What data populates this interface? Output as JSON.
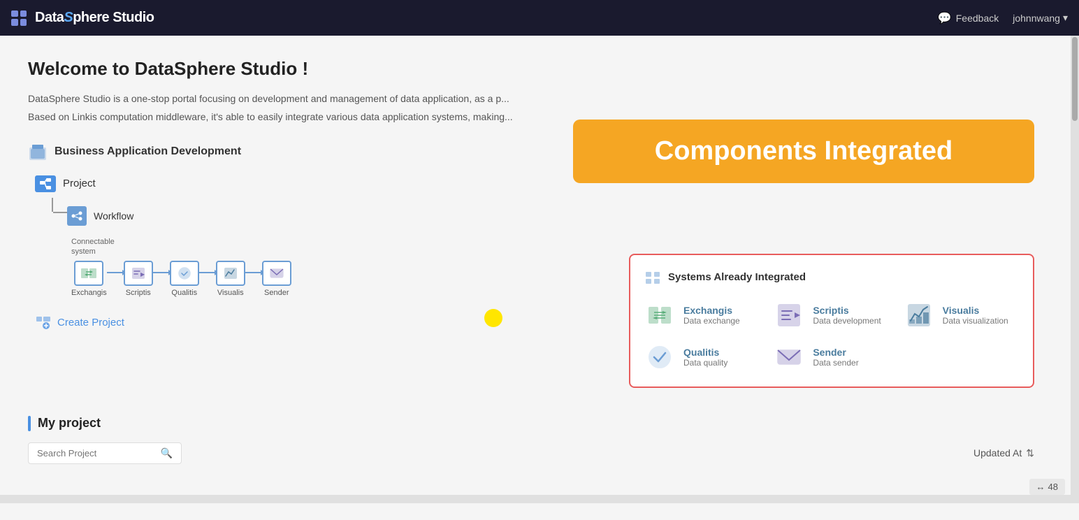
{
  "header": {
    "logo_text": "DataSphere Studio",
    "logo_s": "S",
    "feedback_label": "Feedback",
    "user_label": "johnnwang",
    "user_chevron": "▾"
  },
  "welcome": {
    "title": "Welcome to DataSphere Studio !",
    "desc1": "DataSphere Studio is a one-stop portal focusing on development and management of data application, as a p...",
    "desc2": "Based on Linkis computation middleware, it's able to easily integrate various data application systems, making..."
  },
  "banner": {
    "text": "Components Integrated"
  },
  "business": {
    "section_title": "Business Application Development",
    "project_label": "Project",
    "workflow_label": "Workflow",
    "connectable_label": "Connectable\nsystem",
    "flow_items": [
      {
        "label": "Exchangis"
      },
      {
        "label": "Scriptis"
      },
      {
        "label": "Qualitis"
      },
      {
        "label": "Visualis"
      },
      {
        "label": "Sender"
      }
    ],
    "create_project_label": "Create Project"
  },
  "systems": {
    "section_title": "Systems Already Integrated",
    "items": [
      {
        "name": "Exchangis",
        "desc": "Data exchange"
      },
      {
        "name": "Scriptis",
        "desc": "Data development"
      },
      {
        "name": "Visualis",
        "desc": "Data visualization"
      },
      {
        "name": "Qualitis",
        "desc": "Data quality"
      },
      {
        "name": "Sender",
        "desc": "Data sender"
      }
    ]
  },
  "my_project": {
    "title": "My project",
    "search_placeholder": "Search Project",
    "updated_at_label": "Updated At",
    "page_count": "48"
  }
}
